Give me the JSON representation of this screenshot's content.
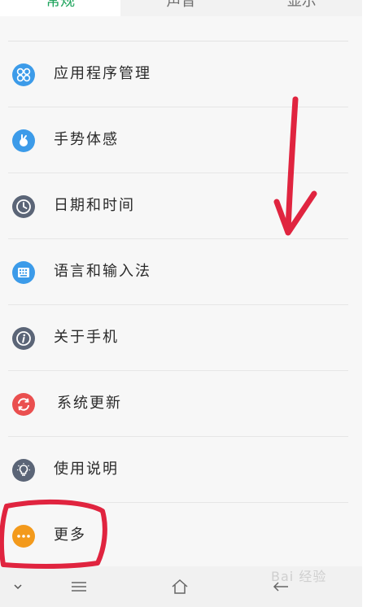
{
  "tabs": [
    {
      "label": "常规",
      "active": true
    },
    {
      "label": "声音",
      "active": false
    },
    {
      "label": "显示",
      "active": false
    }
  ],
  "settings_items": [
    {
      "label": "应用程序管理",
      "icon": "apps-grid-icon",
      "color": "#3c9be9"
    },
    {
      "label": "手势体感",
      "icon": "gesture-hand-icon",
      "color": "#3c9be9"
    },
    {
      "label": "日期和时间",
      "icon": "clock-icon",
      "color": "#5b6577"
    },
    {
      "label": "语言和输入法",
      "icon": "keyboard-icon",
      "color": "#3c9be9"
    },
    {
      "label": "关于手机",
      "icon": "info-icon",
      "color": "#5b6577"
    },
    {
      "label": "系统更新",
      "icon": "refresh-icon",
      "color": "#ea4f4f"
    },
    {
      "label": "使用说明",
      "icon": "lightbulb-icon",
      "color": "#5b6577"
    },
    {
      "label": "更多",
      "icon": "more-dots-icon",
      "color": "#f39a1c"
    }
  ],
  "navbar": {
    "buttons": [
      "chevron-down-icon",
      "menu-icon",
      "home-icon",
      "back-icon"
    ]
  },
  "watermark": {
    "text": "Bai 经验"
  },
  "colors": {
    "accent_green": "#1ca35b",
    "annotation_red": "#e0243f"
  }
}
